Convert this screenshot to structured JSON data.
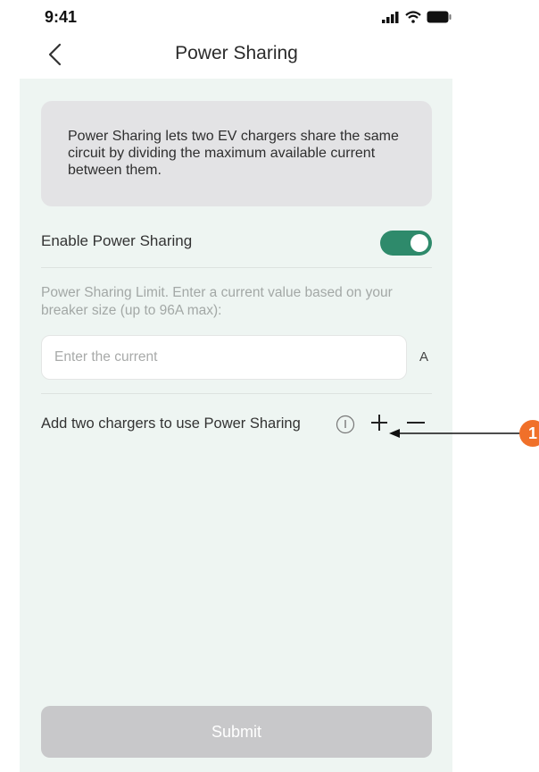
{
  "status_bar": {
    "time": "9:41"
  },
  "nav": {
    "title": "Power Sharing"
  },
  "info_card": {
    "text": "Power Sharing lets two EV chargers share the same circuit by dividing the maximum available current between them."
  },
  "enable": {
    "label": "Enable  Power Sharing",
    "toggle_on": true
  },
  "limit": {
    "hint": "Power Sharing Limit. Enter a current value based on your breaker size (up to 96A max):",
    "placeholder": "Enter the current",
    "value": "",
    "unit": "A"
  },
  "chargers": {
    "label": "Add two chargers to use Power Sharing"
  },
  "submit": {
    "label": "Submit"
  },
  "callout": {
    "number": "1"
  },
  "colors": {
    "accent": "#2e8a6b",
    "panel_bg": "#eef5f2",
    "info_bg": "#e3e3e5",
    "disabled": "#c8c8ca",
    "callout": "#f0702a"
  },
  "icons": [
    "signal-icon",
    "wifi-icon",
    "battery-icon",
    "back-icon",
    "info-icon",
    "plus-icon",
    "minus-icon"
  ]
}
